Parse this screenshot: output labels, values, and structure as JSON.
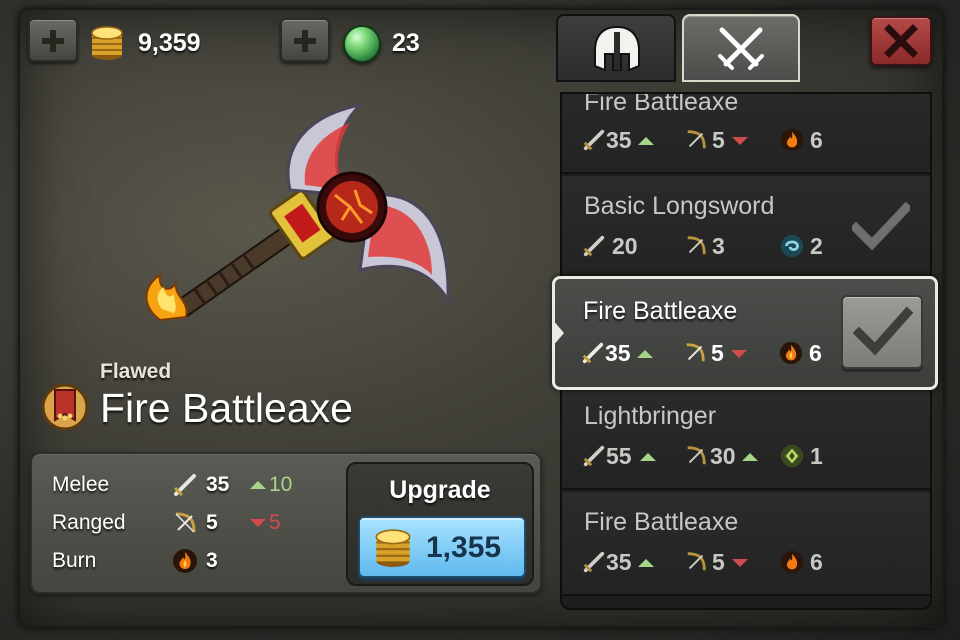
{
  "currency": {
    "gold": "9,359",
    "gems": "23",
    "gold_icon": "gold-coin-icon",
    "gem_icon": "green-gem-icon"
  },
  "tabs": [
    {
      "icon": "helmet-icon",
      "active": false
    },
    {
      "icon": "crossed-swords-icon",
      "active": true
    }
  ],
  "selected_weapon": {
    "quality": "Flawed",
    "name": "Fire Battleaxe",
    "stats": [
      {
        "label": "Melee",
        "icon": "sword-icon",
        "value": "35",
        "delta": "10",
        "delta_dir": "up"
      },
      {
        "label": "Ranged",
        "icon": "bow-icon",
        "value": "5",
        "delta": "5",
        "delta_dir": "down"
      },
      {
        "label": "Burn",
        "icon": "fire-icon",
        "value": "3",
        "delta": "",
        "delta_dir": ""
      }
    ],
    "upgrade": {
      "label": "Upgrade",
      "cost": "1,355"
    }
  },
  "weapon_list": [
    {
      "name": "Fire Battleaxe",
      "melee": "35",
      "melee_dir": "up",
      "ranged": "5",
      "ranged_dir": "down",
      "special": "6",
      "special_icon": "fire-icon",
      "equipped": false
    },
    {
      "name": "Basic Longsword",
      "melee": "20",
      "melee_dir": "",
      "ranged": "3",
      "ranged_dir": "",
      "special": "2",
      "special_icon": "swirl-icon",
      "equipped": true
    },
    {
      "name": "Fire Battleaxe",
      "melee": "35",
      "melee_dir": "up",
      "ranged": "5",
      "ranged_dir": "down",
      "special": "6",
      "special_icon": "fire-icon",
      "equipped": false,
      "selected": true
    },
    {
      "name": "Lightbringer",
      "melee": "55",
      "melee_dir": "up",
      "ranged": "30",
      "ranged_dir": "up",
      "special": "1",
      "special_icon": "leaf-icon",
      "equipped": false
    },
    {
      "name": "Fire Battleaxe",
      "melee": "35",
      "melee_dir": "up",
      "ranged": "5",
      "ranged_dir": "down",
      "special": "6",
      "special_icon": "fire-icon",
      "equipped": false
    }
  ],
  "colors": {
    "delta_up": "#a6d58a",
    "delta_down": "#d04b4b",
    "upgrade_button": "#7cc9f3",
    "close_button": "#a23a3a"
  }
}
